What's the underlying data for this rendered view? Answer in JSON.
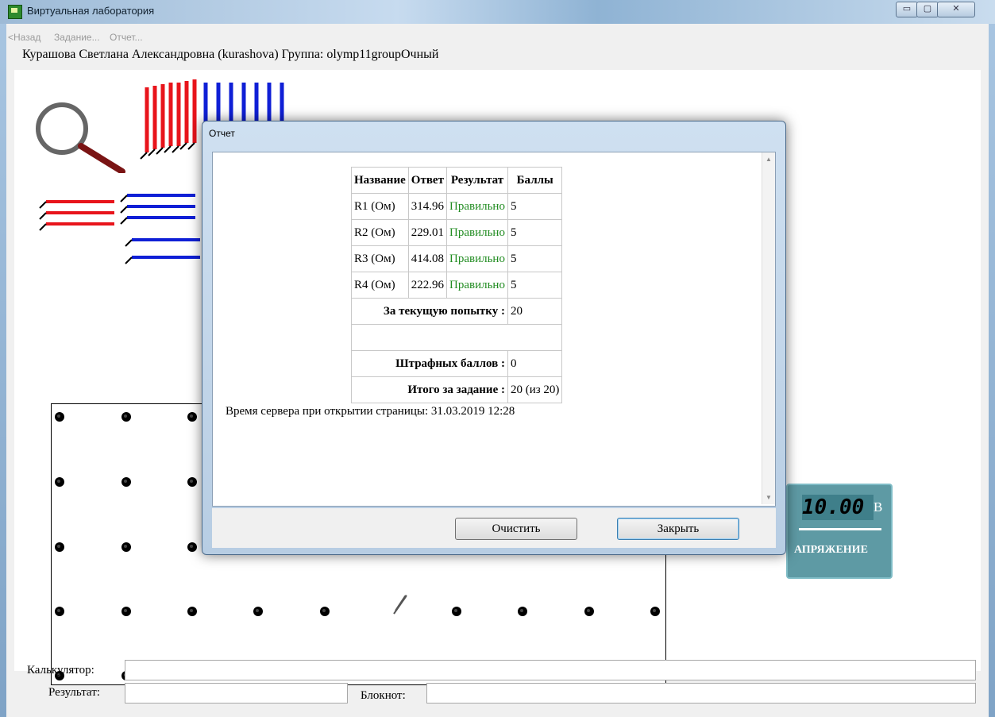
{
  "window": {
    "title": "Виртуальная лаборатория",
    "controls": [
      "▭",
      "▢",
      "✕"
    ]
  },
  "menu": {
    "back": "<Назад",
    "task": "Задание...",
    "report": "Отчет..."
  },
  "user_line": "Курашова Светлана Александровна (kurashova)  Группа: olymp11groupОчный",
  "meter": {
    "display": "10.00",
    "unit": "В",
    "label": "АПРЯЖЕНИЕ"
  },
  "bottom": {
    "calculator_label": "Калькулятор:",
    "result_label": "Результат:",
    "notepad_label": "Блокнот:",
    "calculator_value": "",
    "result_value": "",
    "notepad_value": ""
  },
  "dialog": {
    "title": "Отчет",
    "headers": [
      "Название",
      "Ответ",
      "Результат",
      "Баллы"
    ],
    "rows": [
      {
        "name": "R1 (Ом)",
        "answer": "314.96",
        "result": "Правильно",
        "score": "5"
      },
      {
        "name": "R2 (Ом)",
        "answer": "229.01",
        "result": "Правильно",
        "score": "5"
      },
      {
        "name": "R3 (Ом)",
        "answer": "414.08",
        "result": "Правильно",
        "score": "5"
      },
      {
        "name": "R4 (Ом)",
        "answer": "222.96",
        "result": "Правильно",
        "score": "5"
      }
    ],
    "current_attempt_label": "За текущую попытку :",
    "current_attempt_value": "20",
    "penalty_label": "Штрафных баллов :",
    "penalty_value": "0",
    "total_label": "Итого за задание :",
    "total_value": "20 (из 20)",
    "server_time": "Время сервера при открытии страницы: 31.03.2019 12:28",
    "clear_button": "Очистить",
    "close_button": "Закрыть"
  },
  "colors": {
    "correct": "#218c21",
    "red_wire": "#e8141b",
    "blue_wire": "#0f1fd6"
  }
}
